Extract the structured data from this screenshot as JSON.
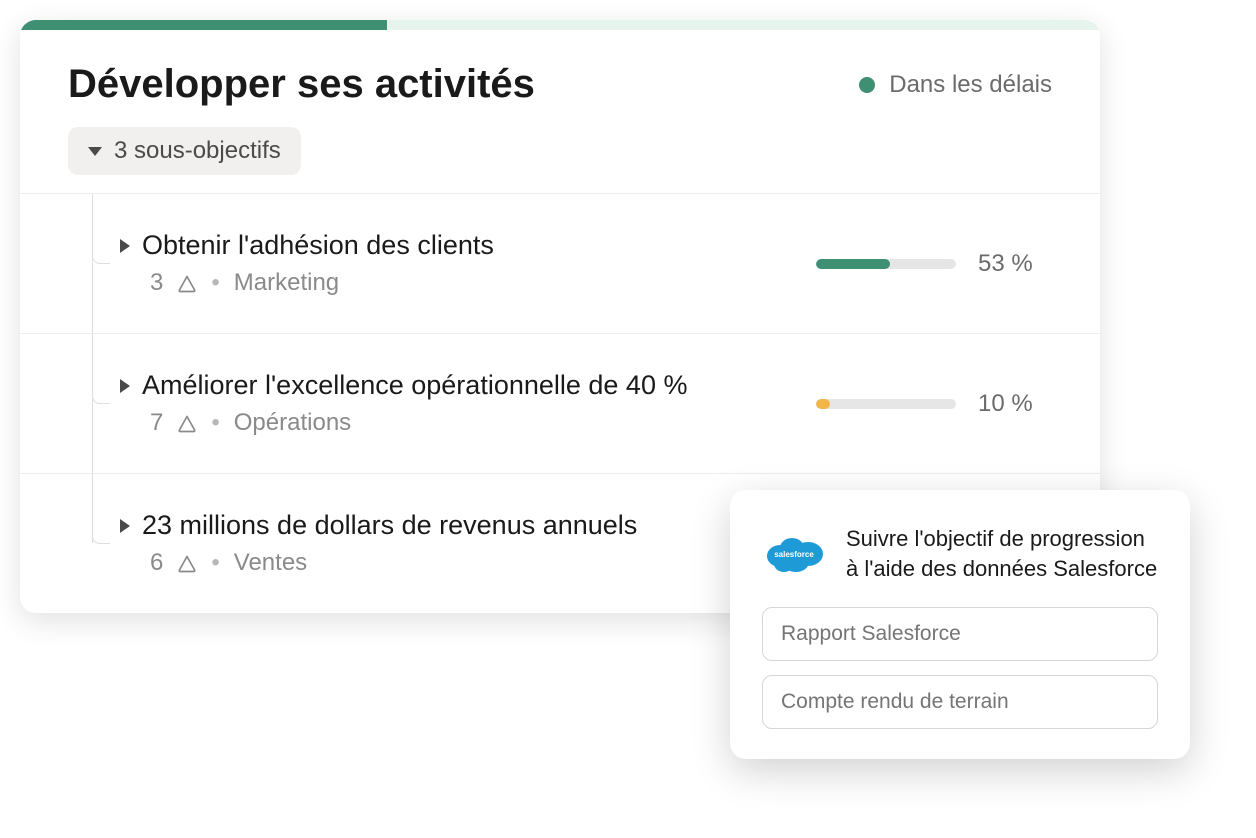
{
  "header": {
    "title": "Développer ses activités",
    "status_label": "Dans les délais",
    "status_color": "#3f8f73",
    "progress_top_pct": 34
  },
  "sub_goals_chip": "3 sous-objectifs",
  "goals": [
    {
      "title": "Obtenir l'adhésion des clients",
      "count": "3",
      "team": "Marketing",
      "progress": 53,
      "progress_label": "53 %",
      "color": "#3f8f73"
    },
    {
      "title": "Améliorer l'excellence opérationnelle de 40 %",
      "count": "7",
      "team": "Opérations",
      "progress": 10,
      "progress_label": "10 %",
      "color": "#f2b54b"
    },
    {
      "title": "23 millions de dollars de revenus annuels",
      "count": "6",
      "team": "Ventes",
      "progress": null,
      "progress_label": "",
      "color": ""
    }
  ],
  "popover": {
    "title": "Suivre l'objectif de progression à l'aide des données Salesforce",
    "input1_placeholder": "Rapport Salesforce",
    "input2_placeholder": "Compte rendu de terrain"
  }
}
